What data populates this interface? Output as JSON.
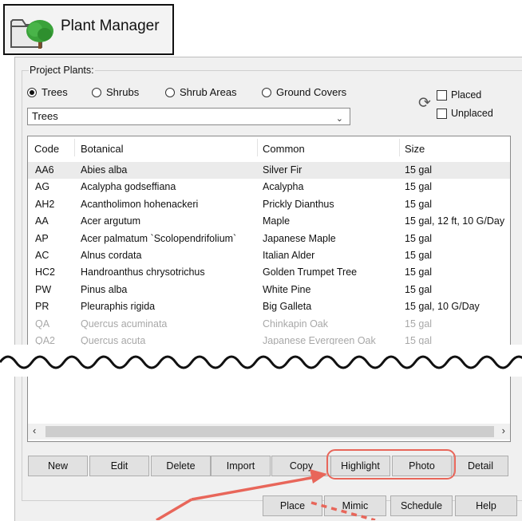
{
  "app": {
    "title": "Plant Manager",
    "icon": "folder-tree-icon"
  },
  "group_label": "Project Plants:",
  "radios": [
    {
      "label": "Trees",
      "checked": true
    },
    {
      "label": "Shrubs",
      "checked": false
    },
    {
      "label": "Shrub Areas",
      "checked": false
    },
    {
      "label": "Ground Covers",
      "checked": false
    }
  ],
  "dropdown": {
    "value": "Trees"
  },
  "filters": {
    "placed": "Placed",
    "unplaced": "Unplaced",
    "refresh_icon": "refresh-icon"
  },
  "table": {
    "columns": [
      "Code",
      "Botanical",
      "Common",
      "Size"
    ],
    "rows": [
      {
        "code": "AA6",
        "botanical": "Abies alba",
        "common": "Silver Fir",
        "size": "15 gal"
      },
      {
        "code": "AG",
        "botanical": "Acalypha godseffiana",
        "common": "Acalypha",
        "size": "15 gal"
      },
      {
        "code": "AH2",
        "botanical": "Acantholimon hohenackeri",
        "common": "Prickly Dianthus",
        "size": "15 gal"
      },
      {
        "code": "AA",
        "botanical": "Acer argutum",
        "common": "Maple",
        "size": "15 gal, 12 ft, 10 G/Day"
      },
      {
        "code": "AP",
        "botanical": "Acer palmatum `Scolopendrifolium`",
        "common": "Japanese Maple",
        "size": "15 gal"
      },
      {
        "code": "AC",
        "botanical": "Alnus cordata",
        "common": "Italian Alder",
        "size": "15 gal"
      },
      {
        "code": "HC2",
        "botanical": "Handroanthus chrysotrichus",
        "common": "Golden Trumpet Tree",
        "size": "15 gal"
      },
      {
        "code": "PW",
        "botanical": "Pinus alba",
        "common": "White Pine",
        "size": "15 gal"
      },
      {
        "code": "PR",
        "botanical": "Pleuraphis rigida",
        "common": "Big Galleta",
        "size": "15 gal, 10 G/Day"
      },
      {
        "code": "QA",
        "botanical": "Quercus acuminata",
        "common": "Chinkapin Oak",
        "size": "15 gal"
      },
      {
        "code": "QA2",
        "botanical": "Quercus acuta",
        "common": "Japanese Evergreen Oak",
        "size": "15 gal"
      }
    ]
  },
  "buttons_row1": [
    "New",
    "Edit",
    "Delete",
    "Import",
    "Copy",
    "Highlight",
    "Photo",
    "Detail"
  ],
  "buttons_row2": [
    "Place",
    "Mimic",
    "Schedule",
    "Help"
  ],
  "colors": {
    "callout": "#e8665a",
    "selected_row": "#ebebeb"
  }
}
